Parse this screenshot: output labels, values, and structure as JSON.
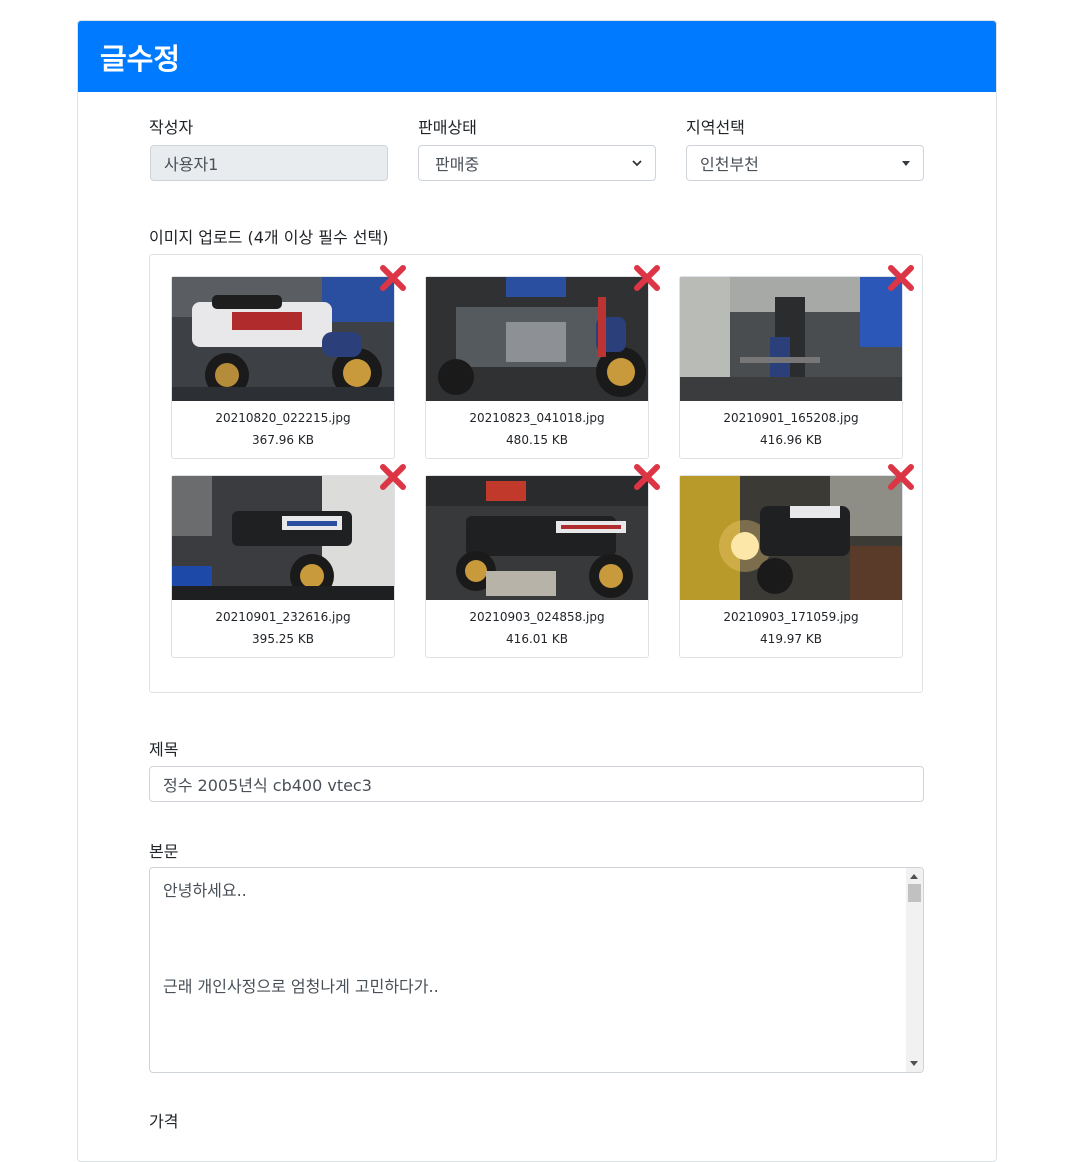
{
  "header": {
    "title": "글수정"
  },
  "author": {
    "label": "작성자",
    "value": "사용자1"
  },
  "sale_status": {
    "label": "판매상태",
    "value": "판매중"
  },
  "region": {
    "label": "지역선택",
    "value": "인천부천"
  },
  "upload": {
    "label": "이미지 업로드 (4개 이상 필수 선택)",
    "images": [
      {
        "filename": "20210820_022215.jpg",
        "size": "367.96 KB"
      },
      {
        "filename": "20210823_041018.jpg",
        "size": "480.15 KB"
      },
      {
        "filename": "20210901_165208.jpg",
        "size": "416.96 KB"
      },
      {
        "filename": "20210901_232616.jpg",
        "size": "395.25 KB"
      },
      {
        "filename": "20210903_024858.jpg",
        "size": "416.01 KB"
      },
      {
        "filename": "20210903_171059.jpg",
        "size": "419.97 KB"
      }
    ]
  },
  "title_field": {
    "label": "제목",
    "value": "정수 2005년식 cb400 vtec3"
  },
  "body_field": {
    "label": "본문",
    "lines": [
      "안녕하세요..",
      "근래 개인사정으로 엄청나게 고민하다가.."
    ]
  },
  "price_field": {
    "label": "가격"
  },
  "icons": {
    "delete": "close-x-icon",
    "select_arrow": "chevron-down-icon",
    "dropdown_caret": "caret-down-icon"
  },
  "colors": {
    "primary": "#007bff",
    "delete": "#dc3545"
  }
}
